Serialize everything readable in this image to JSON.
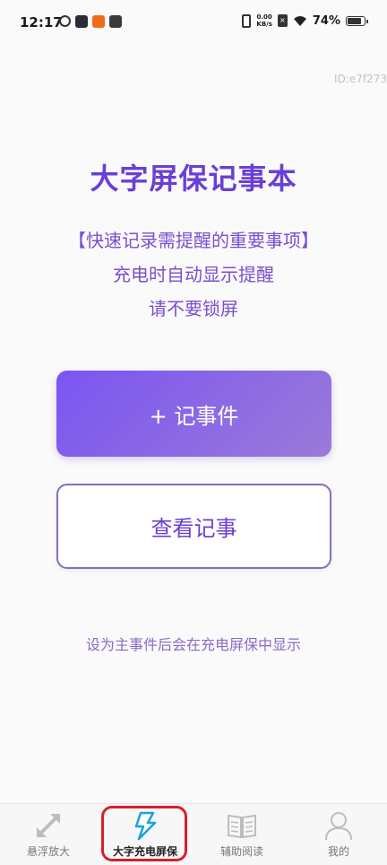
{
  "status_bar": {
    "time": "12:17",
    "net_speed_value": "0.00",
    "net_speed_unit": "KB/s",
    "battery_percent": "74%",
    "battery_level": 0.74
  },
  "device_id": "ID:e7f273",
  "main": {
    "title": "大字屏保记事本",
    "subtitle_line1": "【快速记录需提醒的重要事项】",
    "subtitle_line2": "充电时自动显示提醒",
    "subtitle_line3": "请不要锁屏",
    "add_button_label": "+ 记事件",
    "view_button_label": "查看记事",
    "hint": "设为主事件后会在充电屏保中显示"
  },
  "nav": {
    "items": [
      {
        "label": "悬浮放大",
        "icon": "expand-arrows-icon"
      },
      {
        "label": "大字充电屏保",
        "icon": "lightning-icon",
        "active": true
      },
      {
        "label": "辅助阅读",
        "icon": "open-book-icon"
      },
      {
        "label": "我的",
        "icon": "person-icon"
      }
    ]
  },
  "colors": {
    "accent": "#6a3fd6",
    "button_gradient_start": "#7b55f2",
    "button_gradient_end": "#9a7ad8",
    "highlight": "#d81e2a",
    "active_icon": "#1aa3d9"
  }
}
